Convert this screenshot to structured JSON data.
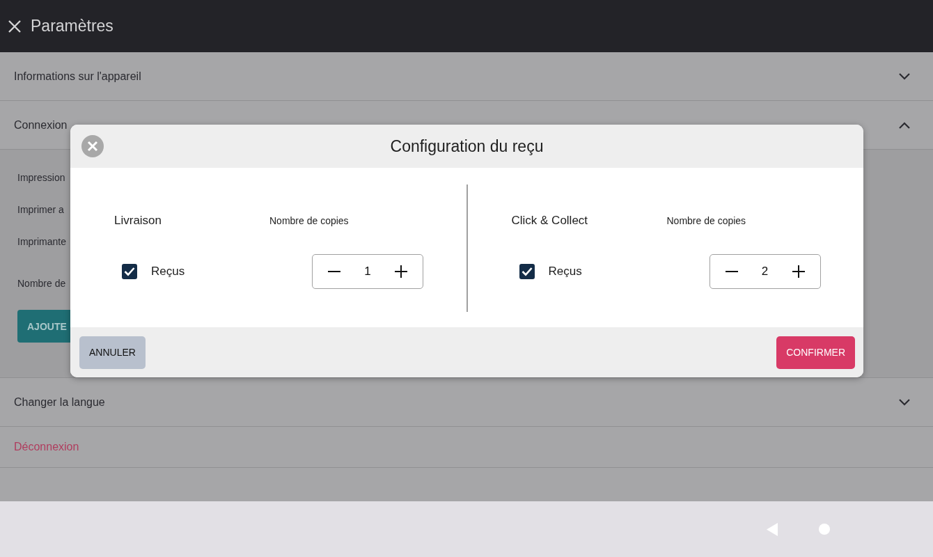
{
  "header": {
    "title": "Paramètres"
  },
  "sections": [
    {
      "title": "Informations sur l'appareil",
      "expanded": false
    },
    {
      "title": "Connexion",
      "expanded": true,
      "items": [
        "Impression",
        "Imprimer a",
        "Imprimante",
        "Nombre de"
      ],
      "add_button": "AJOUTE"
    },
    {
      "title": "Changer la langue",
      "expanded": false
    }
  ],
  "logout": "Déconnexion",
  "dialog": {
    "title": "Configuration du reçu",
    "columns": [
      {
        "heading": "Livraison",
        "copies_label": "Nombre de copies",
        "option": {
          "label": "Reçus",
          "checked": true
        },
        "copies": "1"
      },
      {
        "heading": "Click & Collect",
        "copies_label": "Nombre de copies",
        "option": {
          "label": "Reçus",
          "checked": true
        },
        "copies": "2"
      }
    ],
    "cancel": "ANNULER",
    "confirm": "CONFIRMER"
  }
}
